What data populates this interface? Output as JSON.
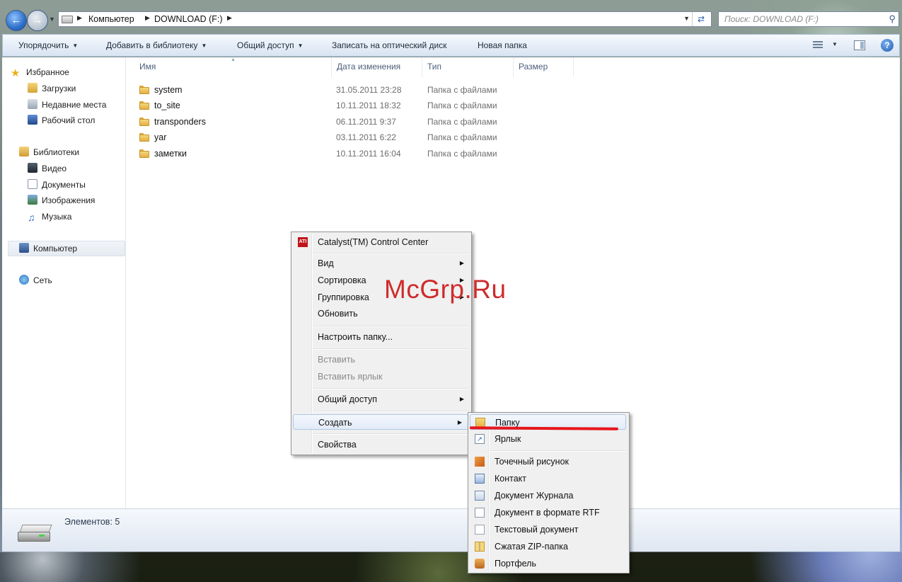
{
  "address_bar": {
    "crumbs": [
      "Компьютер",
      "DOWNLOAD (F:)"
    ],
    "search_placeholder": "Поиск: DOWNLOAD (F:)"
  },
  "toolbar": {
    "organize": "Упорядочить",
    "add_to_library": "Добавить в библиотеку",
    "share": "Общий доступ",
    "burn": "Записать на оптический диск",
    "new_folder": "Новая папка"
  },
  "navigation": {
    "favorites": "Избранное",
    "downloads": "Загрузки",
    "recent": "Недавние места",
    "desktop": "Рабочий стол",
    "libraries": "Библиотеки",
    "video": "Видео",
    "documents": "Документы",
    "pictures": "Изображения",
    "music": "Музыка",
    "computer": "Компьютер",
    "network": "Сеть"
  },
  "columns": {
    "name": "Имя",
    "date": "Дата изменения",
    "type": "Тип",
    "size": "Размер"
  },
  "files": [
    {
      "name": "system",
      "date": "31.05.2011 23:28",
      "type": "Папка с файлами"
    },
    {
      "name": "to_site",
      "date": "10.11.2011 18:32",
      "type": "Папка с файлами"
    },
    {
      "name": "transponders",
      "date": "06.11.2011 9:37",
      "type": "Папка с файлами"
    },
    {
      "name": "yar",
      "date": "03.11.2011 6:22",
      "type": "Папка с файлами"
    },
    {
      "name": "заметки",
      "date": "10.11.2011 16:04",
      "type": "Папка с файлами"
    }
  ],
  "status": {
    "items_count": "Элементов: 5"
  },
  "context_menu": {
    "catalyst": "Catalyst(TM) Control Center",
    "view": "Вид",
    "sort": "Сортировка",
    "group": "Группировка",
    "refresh": "Обновить",
    "customize": "Настроить папку...",
    "paste": "Вставить",
    "paste_shortcut": "Вставить ярлык",
    "share": "Общий доступ",
    "create": "Создать",
    "properties": "Свойства"
  },
  "submenu": {
    "folder": "Папку",
    "shortcut": "Ярлык",
    "bitmap": "Точечный рисунок",
    "contact": "Контакт",
    "journal": "Документ Журнала",
    "rtf": "Документ в формате RTF",
    "text": "Текстовый документ",
    "zip": "Сжатая ZIP-папка",
    "briefcase": "Портфель"
  },
  "watermark": "McGrp.Ru",
  "colors": {
    "highlight_line": "#e8151d",
    "watermark": "#cf2b2b"
  }
}
